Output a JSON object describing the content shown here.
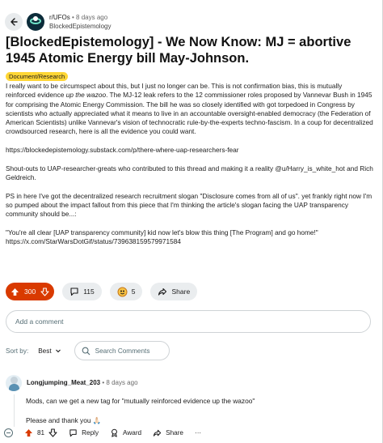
{
  "post": {
    "subreddit": "r/UFOs",
    "age": "8 days ago",
    "author": "BlockedEpistemology",
    "title": "[BlockedEpistemology] - We Now Know: MJ = abortive 1945 Atomic Energy bill May-Johnson.",
    "flair": "Document/Research",
    "body": {
      "p1_a": "I really want to be circumspect about this, but I just no longer can be. This is not confirmation bias, this is mutually reinforced evidence ",
      "p1_em": "up the wazoo",
      "p1_b": ". The MJ-12 leak refers to the 12 commissioner roles proposed by Vannevar Bush in 1945 for comprising the Atomic Energy Commission. The bill he was so closely identified with got torpedoed in Congress by scientists who actually appreciated what it means to live in an accountable oversight-enabled democracy (the Federation of American Scientists) unlike Vannevar's vision of technocratic rule-by-the-experts techno-fascism. In a coup for decentralized crowdsourced research, here is all the evidence you could want.",
      "p2": "https://blockedepistemology.substack.com/p/there-where-uap-researchers-fear",
      "p3": "Shout-outs to UAP-researcher-greats who contributed to this thread and making it a reality @u/Harry_is_white_hot and Rich Geldreich.",
      "p4": "PS in here I've got the decentralized research recruitment slogan \"Disclosure comes from all of us\". yet frankly right now I'm so pumped about the impact fallout from this piece that I'm thinking the article's slogan facing the UAP transparency community should be...:",
      "p5_a": "\"You're all clear [UAP transparency community] kid now let's blow this thing [The Program] and go home!\"",
      "p5_b": "https://x.com/StarWarsDotGif/status/739638159579971584"
    }
  },
  "actions": {
    "score": "300",
    "comments": "115",
    "awards": "5",
    "share": "Share"
  },
  "add_comment_placeholder": "Add a comment",
  "sort": {
    "label": "Sort by:",
    "value": "Best",
    "search_placeholder": "Search Comments"
  },
  "comment": {
    "user": "Longjumping_Meat_203",
    "age": "8 days ago",
    "line1": "Mods, can we get a new tag for \"mutually reinforced evidence up the wazoo\"",
    "line2": "Please and thank you 🙏🏻",
    "score": "81",
    "reply": "Reply",
    "award": "Award",
    "share": "Share",
    "more": "···"
  },
  "colors": {
    "upvote_active": "#d93a00",
    "flair": "#ffd635",
    "pill_bg": "#eaedef"
  }
}
